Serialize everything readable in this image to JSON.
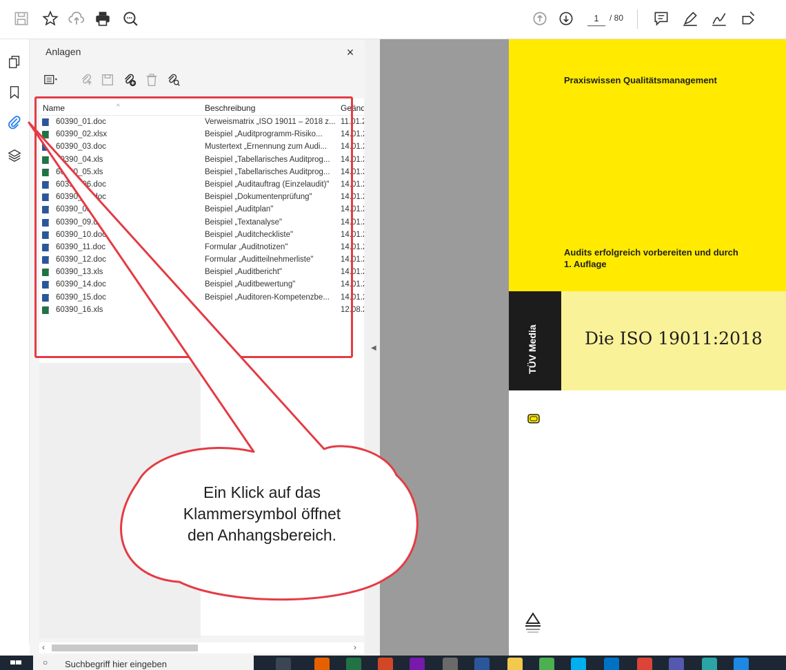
{
  "toolbar": {
    "icons": [
      "save-icon",
      "star-icon",
      "upload-icon",
      "print-icon",
      "zoom-icon"
    ],
    "right_icons": [
      "page-up-icon",
      "page-down-icon",
      "comment-icon",
      "highlight-icon",
      "sign-icon",
      "fill-sign-icon"
    ],
    "page_current": "1",
    "page_total": "/ 80"
  },
  "panel": {
    "title": "Anlagen",
    "close": "×",
    "columns": {
      "name": "Name",
      "description": "Beschreibung",
      "date": "Geänd"
    },
    "files": [
      {
        "name": "60390_01.doc",
        "desc": "Verweismatrix „ISO 19011 – 2018 z...",
        "date": "11.01.2",
        "type": "word"
      },
      {
        "name": "60390_02.xlsx",
        "desc": "Beispiel „Auditprogramm-Risiko...",
        "date": "14.01.2",
        "type": "excel"
      },
      {
        "name": "60390_03.doc",
        "desc": "Mustertext „Ernennung zum Audi...",
        "date": "14.01.2",
        "type": "word"
      },
      {
        "name": "60390_04.xls",
        "desc": "Beispiel „Tabellarisches Auditprog...",
        "date": "14.01.2",
        "type": "excel"
      },
      {
        "name": "60390_05.xls",
        "desc": "Beispiel „Tabellarisches Auditprog...",
        "date": "14.01.2",
        "type": "excel"
      },
      {
        "name": "60390_06.doc",
        "desc": "Beispiel „Auditauftrag (Einzelaudit)\"",
        "date": "14.01.2",
        "type": "word"
      },
      {
        "name": "60390_07.doc",
        "desc": "Beispiel „Dokumentenprüfung\"",
        "date": "14.01.2",
        "type": "word"
      },
      {
        "name": "60390_08.doc",
        "desc": "Beispiel „Auditplan\"",
        "date": "14.01.2",
        "type": "word"
      },
      {
        "name": "60390_09.doc",
        "desc": "Beispiel „Textanalyse\"",
        "date": "14.01.2",
        "type": "word"
      },
      {
        "name": "60390_10.doc",
        "desc": "Beispiel „Auditcheckliste\"",
        "date": "14.01.2",
        "type": "word"
      },
      {
        "name": "60390_11.doc",
        "desc": "Formular „Auditnotizen\"",
        "date": "14.01.2",
        "type": "word"
      },
      {
        "name": "60390_12.doc",
        "desc": "Formular „Auditteilnehmerliste\"",
        "date": "14.01.2",
        "type": "word"
      },
      {
        "name": "60390_13.xls",
        "desc": "Beispiel „Auditbericht\"",
        "date": "14.01.2",
        "type": "excel"
      },
      {
        "name": "60390_14.doc",
        "desc": "Beispiel „Auditbewertung\"",
        "date": "14.01.2",
        "type": "word"
      },
      {
        "name": "60390_15.doc",
        "desc": "Beispiel „Auditoren-Kompetenzbe...",
        "date": "14.01.2",
        "type": "word"
      },
      {
        "name": "60390_16.xls",
        "desc": "",
        "date": "12.08.2",
        "type": "excel"
      }
    ]
  },
  "document": {
    "header": "Praxiswissen Qualitätsmanagement",
    "subtitle1": "Audits erfolgreich vorbereiten und durch",
    "subtitle2": "1. Auflage",
    "publisher": "TÜV Media",
    "title": "Die ISO 19011:2018"
  },
  "callout": {
    "line1": "Ein Klick auf das",
    "line2": "Klammersymbol öffnet",
    "line3": "den Anhangsbereich."
  },
  "taskbar": {
    "search_placeholder": "Suchbegriff hier eingeben"
  },
  "colors": {
    "accent_red": "#e43b44",
    "doc_yellow": "#ffea00",
    "doc_pale": "#f9f298",
    "word": "#2b579a",
    "excel": "#217346"
  }
}
